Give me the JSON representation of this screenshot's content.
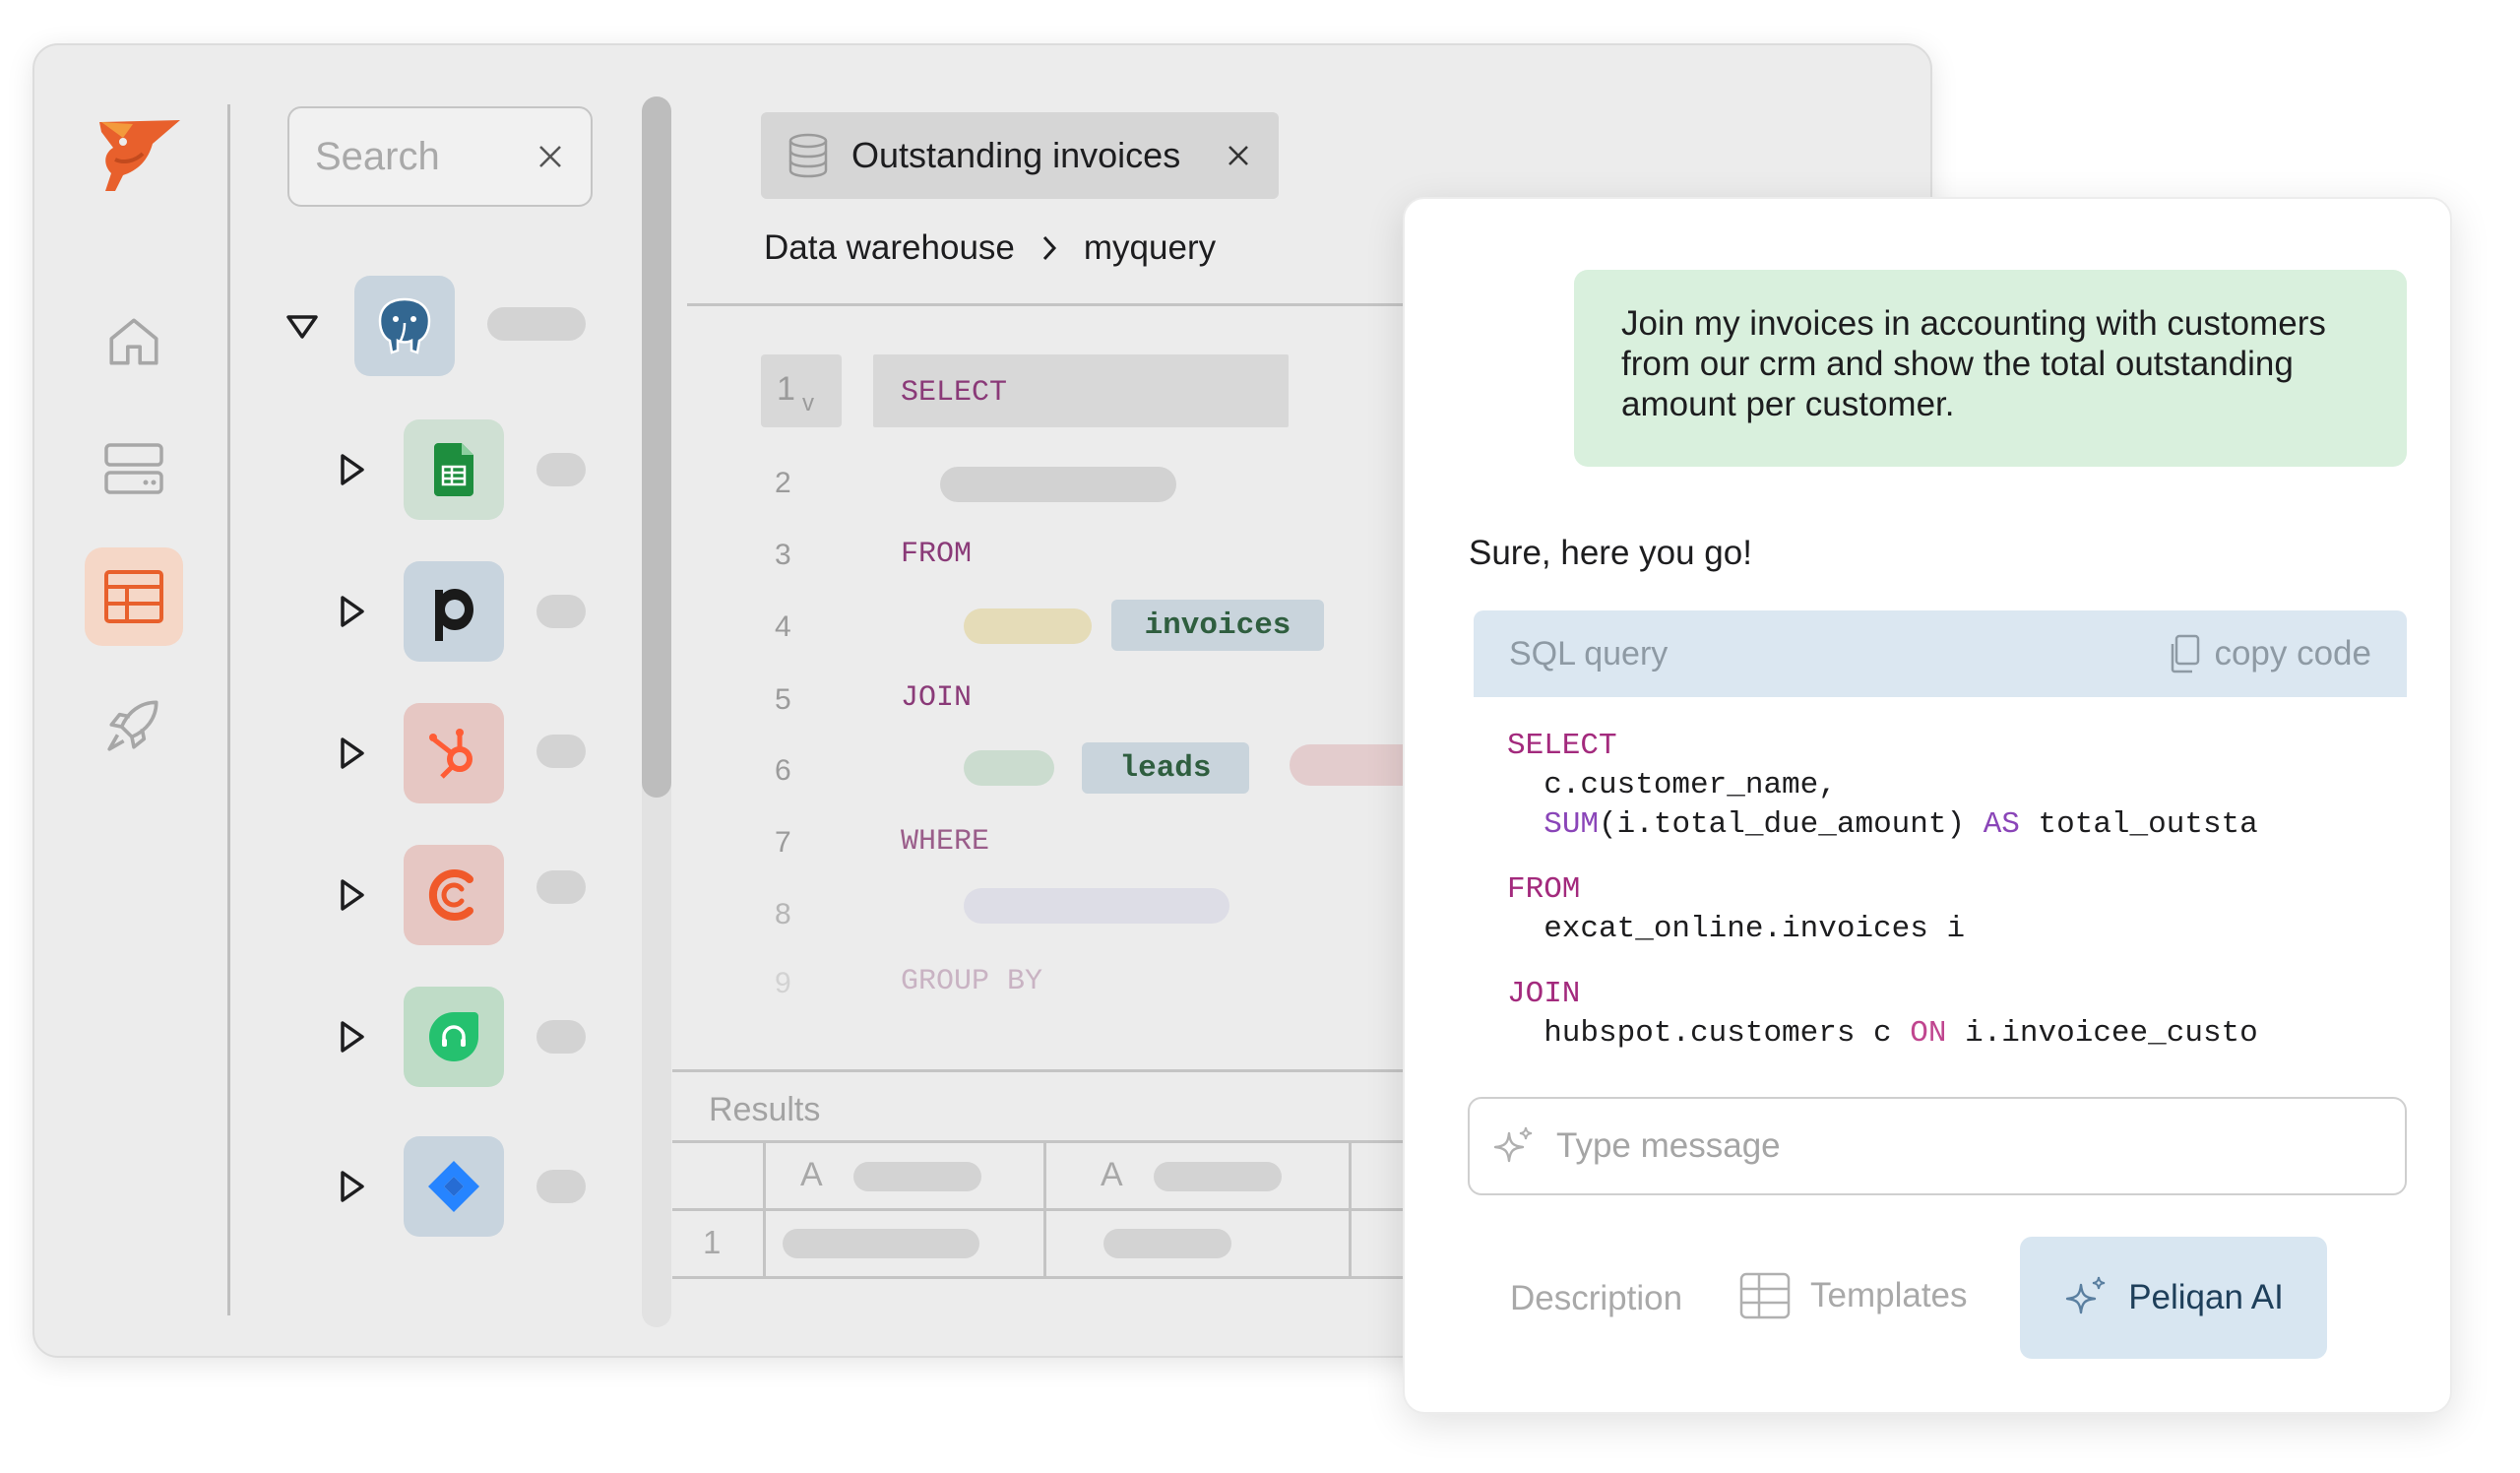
{
  "editor": {
    "search_placeholder": "Search",
    "tab_label": "Outstanding invoices",
    "breadcrumb": [
      "Data warehouse",
      "myquery"
    ],
    "line_numbers": [
      "1",
      "2",
      "3",
      "4",
      "5",
      "6",
      "7",
      "8",
      "9"
    ],
    "fold_marker": "v",
    "keywords": [
      "SELECT",
      "FROM",
      "JOIN",
      "WHERE",
      "GROUP BY"
    ],
    "tables": [
      "invoices",
      "leads"
    ],
    "results_label": "Results",
    "results_columns": [
      "A",
      "A"
    ],
    "results_rows": [
      "1"
    ],
    "connector_icons": [
      "postgresql-icon",
      "google-sheets-icon",
      "pipedrive-icon",
      "hubspot-icon",
      "chargebee-icon",
      "freshdesk-icon",
      "jira-icon"
    ],
    "nav_icons": [
      "home-icon",
      "server-icon",
      "table-icon",
      "rocket-icon"
    ],
    "accent": "#e8602c"
  },
  "chat": {
    "user_message": "Join my invoices in accounting with customers from our crm and show the total outstanding amount per customer.",
    "ai_reply": "Sure, here you go!",
    "code_title": "SQL query",
    "copy_label": "copy code",
    "code": {
      "l1": "SELECT",
      "l2": "  c.customer_name,",
      "l3_fn": "SUM",
      "l3_mid": "(i.total_due_amount) ",
      "l3_as": "AS",
      "l3_tail": " total_outsta",
      "l4": "FROM",
      "l5": "  excat_online.invoices i",
      "l6": "JOIN",
      "l7_a": "  hubspot.customers c ",
      "l7_on": "ON",
      "l7_b": " i.invoicee_custo"
    },
    "input_placeholder": "Type message",
    "tabs": {
      "description": "Description",
      "templates": "Templates",
      "ai": "Peliqan AI"
    },
    "colors": {
      "user_bubble": "#d9f0dd",
      "code_header": "#dbe7f1",
      "ai_tab": "#d8e6f1"
    }
  }
}
